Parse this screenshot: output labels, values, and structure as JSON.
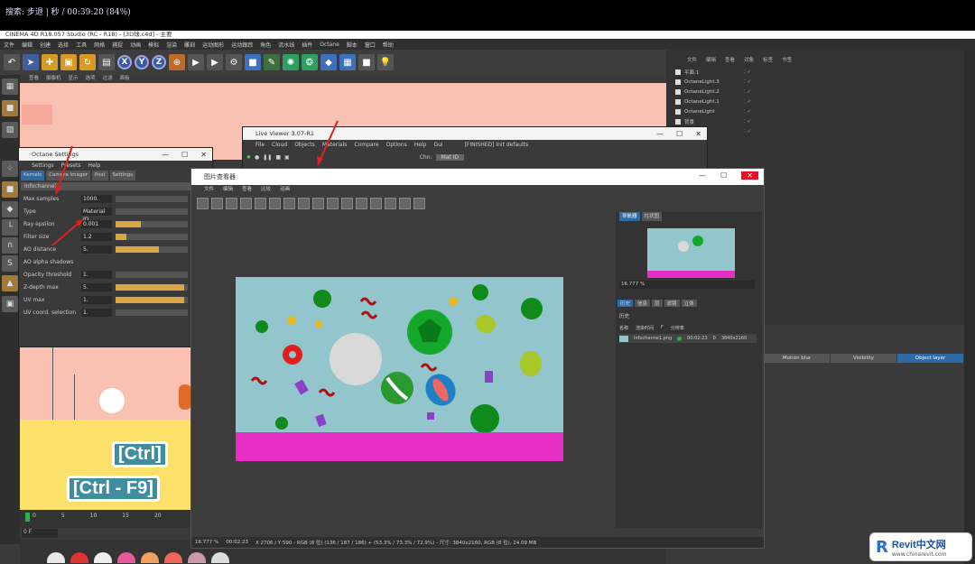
{
  "player": {
    "text": "搜索: 步退 | 秒 / 00:39:20 (84%)"
  },
  "app": {
    "title": "CINEMA 4D R18.057 Studio (RC - R18) - [3D球.c4d] - 主要"
  },
  "menu": [
    "文件",
    "编辑",
    "创建",
    "选择",
    "工具",
    "网格",
    "捕捉",
    "动画",
    "模拟",
    "渲染",
    "雕刻",
    "运动图形",
    "运动跟踪",
    "角色",
    "流水线",
    "插件",
    "Octane",
    "脚本",
    "窗口",
    "帮助"
  ],
  "toolbar": {
    "axes": [
      "X",
      "Y",
      "Z"
    ]
  },
  "viewport_menu": [
    "查看",
    "摄像机",
    "显示",
    "选项",
    "过滤",
    "面板"
  ],
  "object_manager": {
    "tabs": [
      "文件",
      "编辑",
      "查看",
      "对象",
      "标签",
      "书签"
    ],
    "items": [
      "平面.1",
      "OctaneLight.3",
      "OctaneLight.2",
      "OctaneLight.1",
      "OctaneLight",
      "背景",
      "Camera"
    ]
  },
  "attributes": {
    "tabs": [
      "Motion blur",
      "Visibility",
      "Object layer"
    ],
    "selected": "Object layer"
  },
  "octane_settings": {
    "title": "Octane Settings",
    "menu": [
      "Settings",
      "Presets",
      "Help"
    ],
    "tabs": [
      "Kernels",
      "Camera Imager",
      "Post",
      "Settings"
    ],
    "kernel": "Infochannel",
    "rows": [
      {
        "label": "Max samples",
        "value": "1000.",
        "fill": 0.0
      },
      {
        "label": "Type",
        "value": "Material ID",
        "fill": 0.0
      },
      {
        "label": "Ray epsilon",
        "value": "0.001",
        "fill": 0.35
      },
      {
        "label": "Filter size",
        "value": "1.2",
        "fill": 0.15
      },
      {
        "label": "AO distance",
        "value": "5.",
        "fill": 0.6
      },
      {
        "label": "AO alpha shadows",
        "value": "",
        "fill": 0.0
      },
      {
        "label": "Opacity threshold",
        "value": "1.",
        "fill": 0.0
      },
      {
        "label": "Z-depth max",
        "value": "5.",
        "fill": 0.95
      },
      {
        "label": "UV max",
        "value": "1.",
        "fill": 0.95
      },
      {
        "label": "UV coord. selection",
        "value": "1.",
        "fill": 0.0
      }
    ]
  },
  "live_viewer": {
    "title": "Live Viewer 3.07-R1",
    "menu": [
      "File",
      "Cloud",
      "Objects",
      "Materials",
      "Compare",
      "Options",
      "Help",
      "Gui"
    ],
    "status": "[FINISHED] Init defaults",
    "channel_label": "Chn:",
    "channel_value": "Mat ID"
  },
  "picture_viewer": {
    "title": "图片查看器",
    "menu": [
      "文件",
      "编辑",
      "查看",
      "比较",
      "动画"
    ],
    "right_tabs": [
      "导航器",
      "柱状图"
    ],
    "zoom": "16.777 %",
    "history_tabs": [
      "历史",
      "信息",
      "层",
      "滤镜",
      "立体"
    ],
    "history_label": "历史",
    "history_headers": [
      "名称",
      "渲染时间",
      "F",
      "分辨率"
    ],
    "history_row": {
      "name": "Infochanne1.png",
      "time": "00:02:23",
      "frame": "0",
      "res": "3840x2160"
    },
    "status": {
      "zoom": "16.777 %",
      "time": "00:02:23",
      "info": "X 2706 / Y 590 - RGB (8 位) (136 / 187 / 186) + (53.3% / 73.3% / 72.9%) - 尺寸: 3840x2160, RGB (8 位), 24.09 MB"
    }
  },
  "viewport_labels": {
    "ctrl": "[Ctrl]",
    "ctrl_f9": "[Ctrl - F9]"
  },
  "timeline": {
    "ticks": [
      "0",
      "5",
      "10",
      "15",
      "20"
    ],
    "frame": "0 F"
  },
  "watermark": {
    "brand": "Revit中文网",
    "url": "www.chinarevit.com"
  },
  "colors": {
    "canvas_bg": "#92c5cc",
    "pink_strip": "#e62dc4",
    "peach": "#f8c1b1",
    "green_ball": "#0f8a1b"
  }
}
